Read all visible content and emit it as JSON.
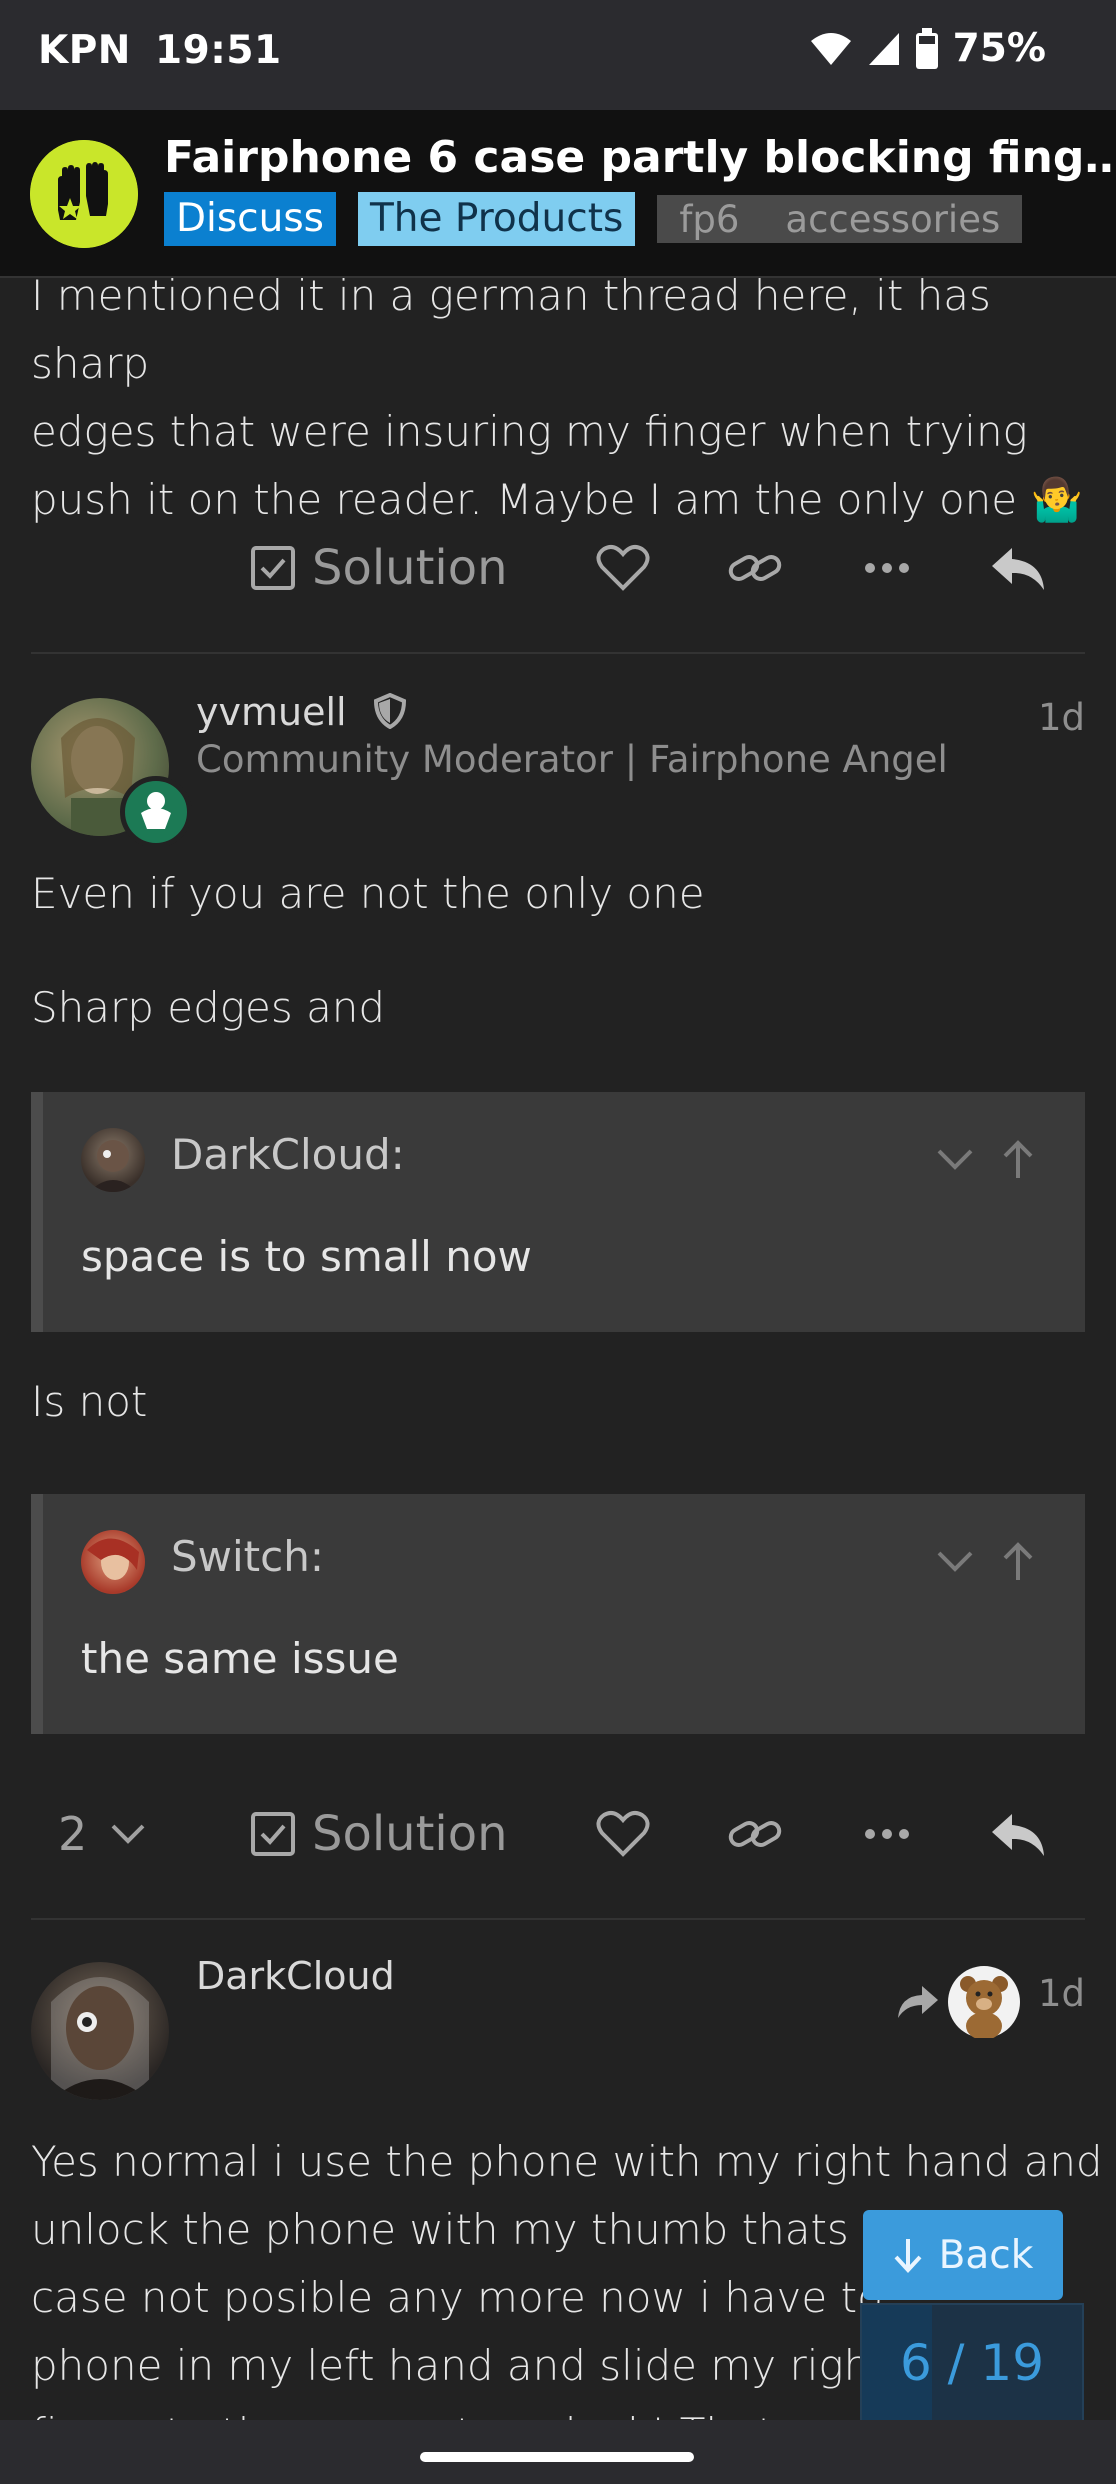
{
  "status_bar": {
    "carrier": "KPN",
    "time": "19:51",
    "battery": "75%"
  },
  "header": {
    "title": "Fairphone 6 case partly blocking fing…",
    "category": "Discuss",
    "subcategory": "The Products",
    "tags": [
      "fp6",
      "accessories"
    ]
  },
  "post1": {
    "lines": [
      "I mentioned it in a german thread here, it has sharp",
      "edges that were insuring my finger when trying",
      "push it on the reader. Maybe I am the only one"
    ],
    "emoji": "🤷‍♂️",
    "solution_label": "Solution"
  },
  "post2": {
    "username": "yvmuell",
    "user_title": "Community Moderator | Fairphone Angel",
    "date": "1d",
    "text1": "Even if you are not the only one",
    "text2": "Sharp edges and",
    "quote1": {
      "name": "DarkCloud:",
      "text": "space is to small now"
    },
    "text3": "Is not",
    "quote2": {
      "name": "Switch:",
      "text": "the same issue"
    },
    "reply_count": "2",
    "solution_label": "Solution"
  },
  "post3": {
    "username": "DarkCloud",
    "date": "1d",
    "lines": [
      "Yes normal i use the phone with my right hand and",
      "unlock the phone with my thumb thats w",
      "case not posible any more now i have to",
      "phone in my left hand and slide my right",
      "finger to the sensor to unlock! That cost"
    ]
  },
  "back_button": {
    "label": "Back"
  },
  "progress": {
    "current": 6,
    "total": 19,
    "text": "6 / 19"
  },
  "colors": {
    "accent": "#3b9bdc",
    "discuss": "#0b80d0",
    "products": "#7fcdf0",
    "background": "#222222"
  }
}
